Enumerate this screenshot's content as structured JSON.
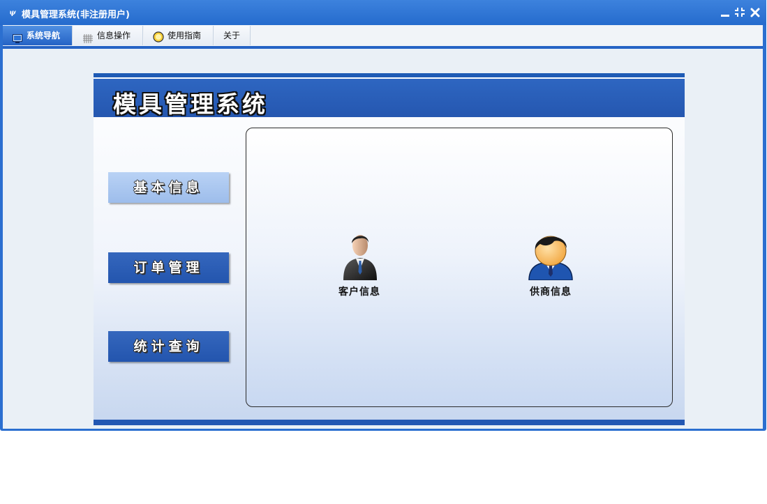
{
  "window": {
    "title": "模具管理系统(非注册用户)",
    "app_icon": "ψ",
    "controls": [
      "minimize-icon",
      "restore-icon",
      "close-icon"
    ]
  },
  "menu": {
    "tabs": [
      {
        "label": "系统导航",
        "icon": "monitor-icon",
        "active": true
      },
      {
        "label": "信息操作",
        "icon": "grid-icon",
        "active": false
      },
      {
        "label": "使用指南",
        "icon": "help-circle-icon",
        "active": false
      },
      {
        "label": "关于",
        "icon": "",
        "active": false
      }
    ]
  },
  "banner": {
    "title": "模具管理系统"
  },
  "sidebar": {
    "buttons": [
      {
        "label": "基本信息",
        "selected": true
      },
      {
        "label": "订单管理",
        "selected": false
      },
      {
        "label": "统计查询",
        "selected": false
      }
    ]
  },
  "main": {
    "tiles": [
      {
        "label": "客户信息",
        "icon": "businessman-icon"
      },
      {
        "label": "供商信息",
        "icon": "person-avatar-icon"
      }
    ]
  },
  "colors": {
    "title_bar": "#2b6fd0",
    "accent": "#2563c5",
    "banner": "#2a5fba",
    "nav_button": "#2a5bb3",
    "nav_button_selected": "#a9c6ef"
  }
}
